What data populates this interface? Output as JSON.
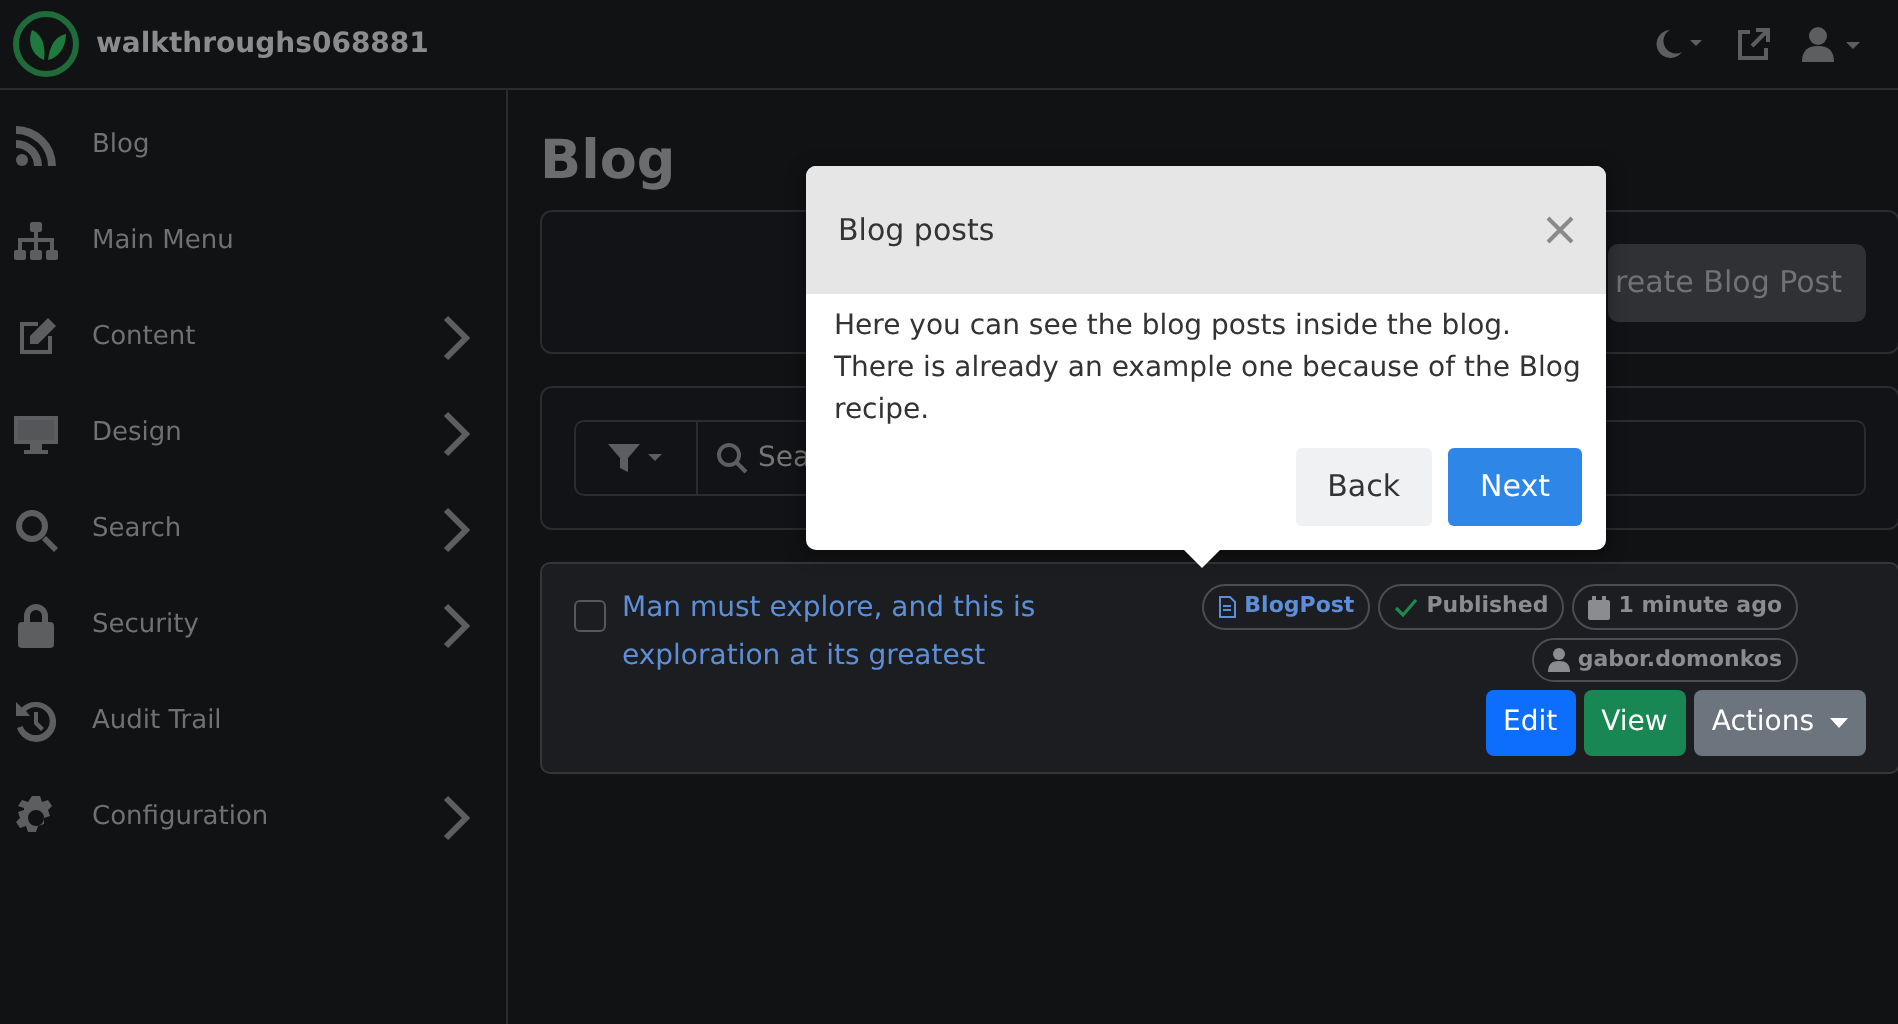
{
  "navbar": {
    "brand": "walkthroughs068881"
  },
  "sidebar": {
    "items": [
      {
        "kind": "rss",
        "label": "Blog",
        "expandable": false
      },
      {
        "kind": "sitemap",
        "label": "Main Menu",
        "expandable": false
      },
      {
        "kind": "edit",
        "label": "Content",
        "expandable": true
      },
      {
        "kind": "monitor",
        "label": "Design",
        "expandable": true
      },
      {
        "kind": "search",
        "label": "Search",
        "expandable": true
      },
      {
        "kind": "lock",
        "label": "Security",
        "expandable": true
      },
      {
        "kind": "history",
        "label": "Audit Trail",
        "expandable": false
      },
      {
        "kind": "gear",
        "label": "Configuration",
        "expandable": true
      }
    ]
  },
  "page": {
    "title": "Blog",
    "create_button": "reate Blog Post",
    "search": {
      "placeholder": "Sea"
    }
  },
  "items": [
    {
      "title": "Man must explore, and this is exploration at its greatest",
      "checked": false,
      "badges": [
        {
          "kind": "type",
          "text": "BlogPost"
        },
        {
          "kind": "status",
          "text": "Published"
        },
        {
          "kind": "date",
          "text": "1 minute ago"
        },
        {
          "kind": "user",
          "text": "gabor.domonkos"
        }
      ],
      "buttons": [
        {
          "kind": "edit",
          "label": "Edit"
        },
        {
          "kind": "view",
          "label": "View"
        },
        {
          "kind": "actions",
          "label": "Actions"
        }
      ]
    }
  ],
  "popover": {
    "title": "Blog posts",
    "body": "Here you can see the blog posts inside the blog. There is already an example one because of the Blog recipe.",
    "buttons": [
      {
        "kind": "back",
        "label": "Back"
      },
      {
        "kind": "next",
        "label": "Next"
      }
    ]
  }
}
